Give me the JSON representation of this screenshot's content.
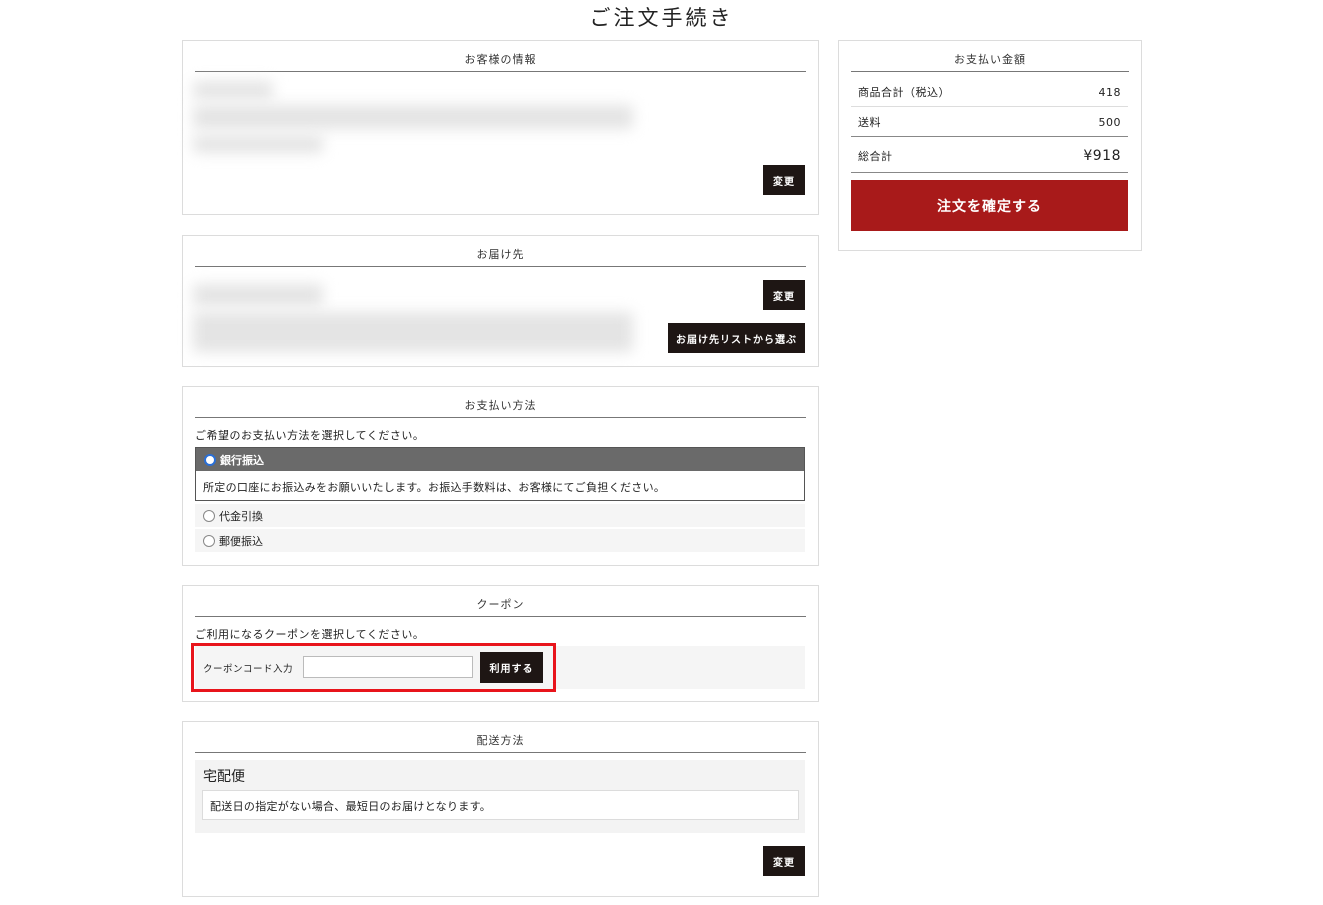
{
  "page": {
    "title": "ご注文手続き"
  },
  "customer": {
    "section_title": "お客様の情報",
    "change_label": "変更"
  },
  "delivery": {
    "section_title": "お届け先",
    "change_label": "変更",
    "list_button_label": "お届け先リストから選ぶ"
  },
  "payment": {
    "section_title": "お支払い方法",
    "intro": "ご希望のお支払い方法を選択してください。",
    "options": [
      {
        "label": "銀行振込",
        "selected": true,
        "description": "所定の口座にお振込みをお願いいたします。お振込手数料は、お客様にてご負担ください。"
      },
      {
        "label": "代金引換",
        "selected": false
      },
      {
        "label": "郵便振込",
        "selected": false
      }
    ]
  },
  "coupon": {
    "section_title": "クーポン",
    "intro": "ご利用になるクーポンを選択してください。",
    "code_label": "クーポンコード入力",
    "code_value": "",
    "apply_label": "利用する",
    "highlight_color": "#e8141b"
  },
  "shipping": {
    "section_title": "配送方法",
    "method_name": "宅配便",
    "note": "配送日の指定がない場合、最短日のお届けとなります。",
    "change_label": "変更"
  },
  "summary": {
    "section_title": "お支払い金額",
    "subtotal_label": "商品合計（税込）",
    "subtotal_value": "418",
    "shipping_label": "送料",
    "shipping_value": "500",
    "total_label": "総合計",
    "total_value": "¥918",
    "confirm_label": "注文を確定する",
    "confirm_color": "#a81a1a"
  }
}
